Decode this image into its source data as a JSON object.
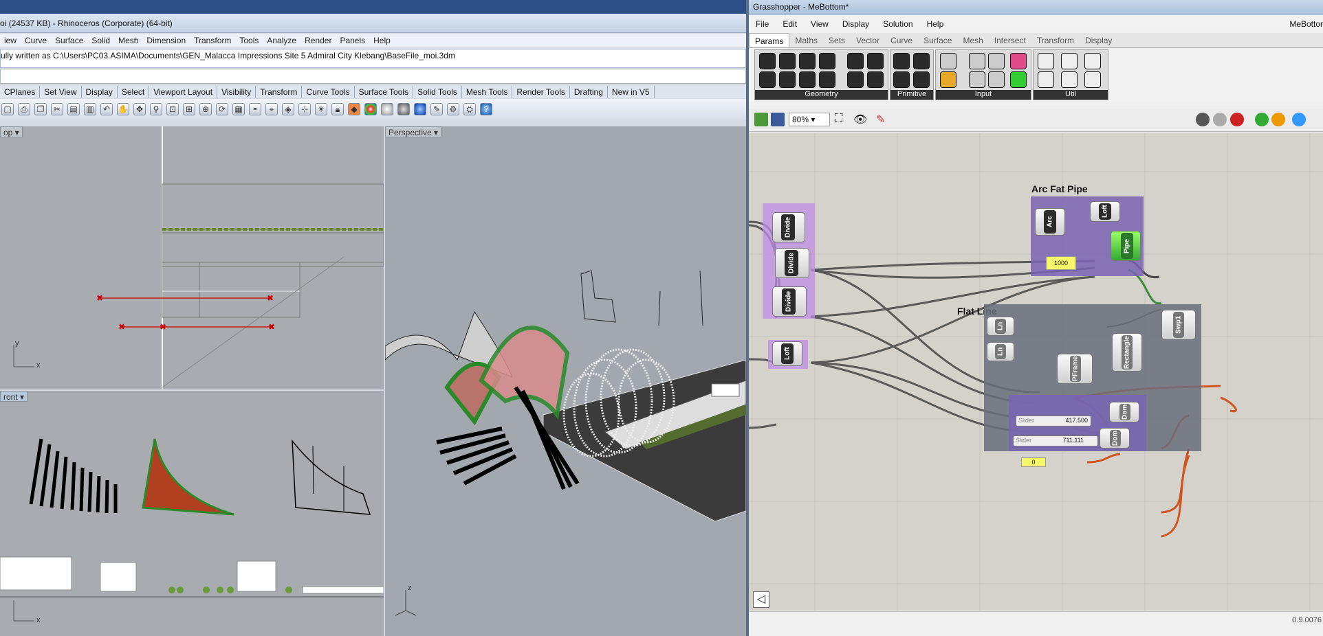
{
  "rhino": {
    "title": "oi (24537 KB) - Rhinoceros (Corporate) (64-bit)",
    "menu": [
      "iew",
      "Curve",
      "Surface",
      "Solid",
      "Mesh",
      "Dimension",
      "Transform",
      "Tools",
      "Analyze",
      "Render",
      "Panels",
      "Help"
    ],
    "command_history": "ully written as C:\\Users\\PC03.ASIMA\\Documents\\GEN_Malacca Impressions Site 5 Admiral City Klebang\\BaseFile_moi.3dm",
    "toolbar_tabs": [
      "CPlanes",
      "Set View",
      "Display",
      "Select",
      "Viewport Layout",
      "Visibility",
      "Transform",
      "Curve Tools",
      "Surface Tools",
      "Solid Tools",
      "Mesh Tools",
      "Render Tools",
      "Drafting",
      "New in V5"
    ],
    "viewports": {
      "top": "op",
      "perspective": "Perspective",
      "front": "ront"
    },
    "axes": {
      "x": "x",
      "y": "y",
      "z": "z"
    }
  },
  "gh": {
    "title": "Grasshopper - MeBottom*",
    "title_right": "MeBottor",
    "menu": [
      "File",
      "Edit",
      "View",
      "Display",
      "Solution",
      "Help"
    ],
    "tabs": [
      "Params",
      "Maths",
      "Sets",
      "Vector",
      "Curve",
      "Surface",
      "Mesh",
      "Intersect",
      "Transform",
      "Display"
    ],
    "ribbon_groups": [
      "Geometry",
      "Primitive",
      "Input",
      "Util"
    ],
    "zoom": "80%",
    "version": "0.9.0076",
    "groups": {
      "arc_title": "Arc Fat Pipe",
      "flat_title": "Flat Line"
    },
    "components": {
      "divide": "Divide",
      "loft": "Loft",
      "arc": "Arc",
      "pipe": "Pipe",
      "ln": "Ln",
      "pframe": "PFrame",
      "rectangle": "Rectangle",
      "swp1": "Swp1",
      "dom": "Dom"
    },
    "panels": {
      "p1000": "1000",
      "p0": "0"
    },
    "sliders": {
      "s1_label": "Slider",
      "s1_value": "417.500",
      "s2_label": "Slider",
      "s2_value": "711.111"
    }
  }
}
